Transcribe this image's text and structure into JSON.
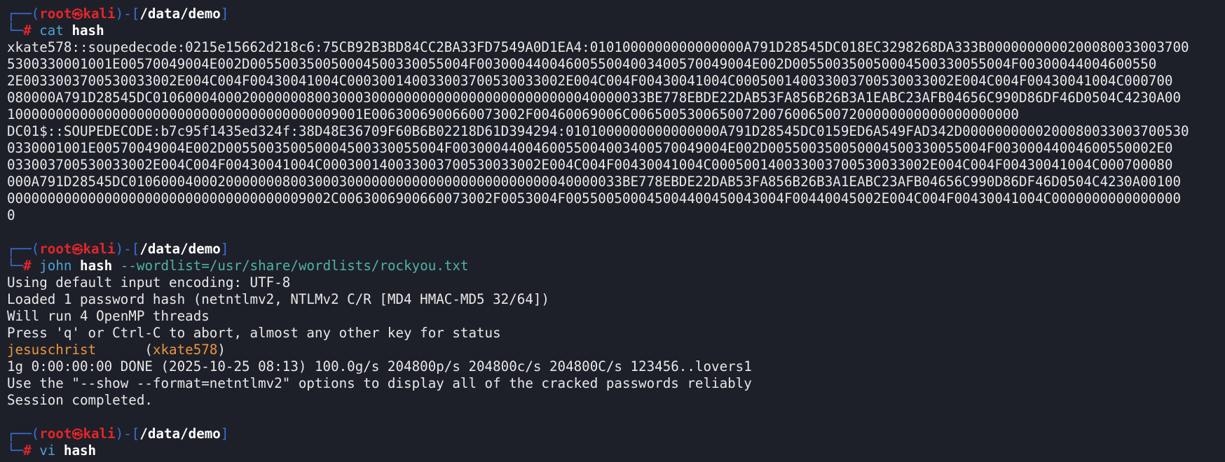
{
  "prompt": {
    "user": "root",
    "skull": "㉿",
    "host": "kali",
    "cwd": "/data/demo",
    "hash_char": "#",
    "top_open": "┌──(",
    "top_mid": ")-[",
    "top_close": "]",
    "bottom": "└─"
  },
  "blocks": [
    {
      "cmd": "cat",
      "args": "hash",
      "opts": "",
      "output": [
        "xkate578::soupedecode:0215e15662d218c6:75CB92B3BD84CC2BA33FD7549A0D1EA4:0101000000000000000A791D28545DC018EC3298268DA333B0000000000200080033003700",
        "5300330001001E00570049004E002D005500350050004500330055004F003000440046005500400340057004900­4E002D005500350050004500330055004F00300044004600550",
        "2E003300370053003300­2E004C004F00430041004C000300140033003700530033002E004C004F00430041004C00050014003300370053003300­2E004C004F00430041004C000700",
        "080000A791D28545DC0106000400020000000800300030000000000000000000000000040000033BE778EBDE22DAB53FA856B26B3A1EABC23AFB04656C990D86DF46D0504C4230A00",
        "10000000000000000000000000000000000000009001E0063006900660073002F00460069006C006500530065007200760065007200000000000000000000",
        "DC01$::SOUPEDECODE:b7c95f1435ed324f:38D48E36709F60B6B02218D61D394294:0101000000000000000A791D28545DC0159ED6A549FAD342D0000000000200080033003700530",
        "0330001001E00570049004E002D005500350050004500330055004F003000440046005500400340057004900­4E002D005500350050004500330055004F00300044004600550002E0",
        "033003700530033002E004C004F00430041004C00030014003300370053003300­2E004C004F00430041004C00050014003300370053003300­2E004C004F00430041004C000700080",
        "000A791D28545DC0106000400020000000800300030000000000000000000000000040000033BE778EBDE22DAB53FA856B26B3A1EABC23AFB04656C990D86DF46D0504C4230A00100",
        "0000000000000000000000000000000000009002C0063006900660073002F0053004F005500500045004400450043004F00440045002E004C004F00430041004C0000000000000000",
        "0"
      ]
    },
    {
      "cmd": "john",
      "args": "hash",
      "opts": "--wordlist=/usr/share/wordlists/rockyou.txt",
      "output": [
        "Using default input encoding: UTF-8",
        "Loaded 1 password hash (netntlmv2, NTLMv2 C/R [MD4 HMAC-MD5 32/64])",
        "Will run 4 OpenMP threads",
        "Press 'q' or Ctrl-C to abort, almost any other key for status",
        {
          "password": "jesuschrist",
          "spacer": "      (",
          "user": "xkate578",
          "close": ")"
        },
        "1g 0:00:00:00 DONE (2025-10-25 08:13) 100.0g/s 204800p/s 204800c/s 204800C/s 123456..lovers1",
        "Use the \"--show --format=netntlmv2\" options to display all of the cracked passwords reliably",
        "Session completed."
      ]
    },
    {
      "cmd": "vi",
      "args": "hash",
      "opts": "",
      "output": []
    }
  ]
}
